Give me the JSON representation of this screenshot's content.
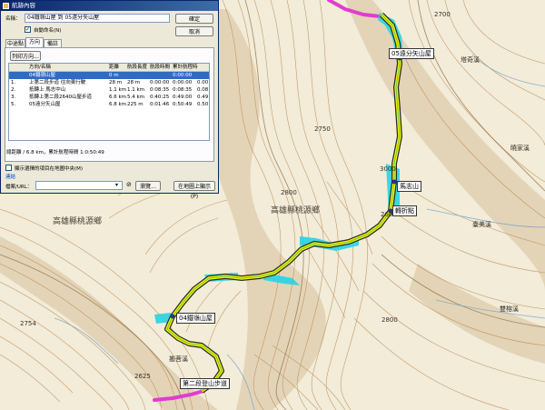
{
  "dialog": {
    "title": "航跡內容",
    "name_label": "名稱：",
    "name_value": "04鐵嶺山屋 到 05遠分矢山屋",
    "auto_name_label": "自動命名(N)",
    "ok_label": "確定",
    "cancel_label": "取消",
    "tabs": [
      {
        "label": "中途點"
      },
      {
        "label": "方向"
      },
      {
        "label": "備註"
      }
    ],
    "print_label": "列印方向...",
    "columns": {
      "name": "方向/名稱",
      "distance": "距離",
      "leg_length": "航段長度",
      "leg_time": "航段時間",
      "total_time": "累計航程時",
      "speed": ""
    },
    "rows": [
      {
        "num": "",
        "name": "04鐵嶺山屋",
        "distance": "0 m",
        "leg_length": "",
        "leg_time": "",
        "total_time": "0:00:00",
        "speed": "",
        "selected": true
      },
      {
        "num": "1.",
        "name": "上第二段步道 往向東行駛",
        "distance": "28 m",
        "leg_length": "28 m",
        "leg_time": "0:00:00",
        "total_time": "0:00:00",
        "speed": "0.00"
      },
      {
        "num": "2.",
        "name": "抵轉上 馬志中山",
        "distance": "1.1 km",
        "leg_length": "1.1 km",
        "leg_time": "0:08:35",
        "total_time": "0:08:35",
        "speed": "0.08"
      },
      {
        "num": "3.",
        "name": "抵轉上第二段2640山屋步道",
        "distance": "6.6 km",
        "leg_length": "5.4 km",
        "leg_time": "0:40:25",
        "total_time": "0:49:00",
        "speed": "0.49"
      },
      {
        "num": "5.",
        "name": "05遠分矢山屋",
        "distance": "6.8 km",
        "leg_length": "225 m",
        "leg_time": "0:01:46",
        "total_time": "0:50:49",
        "speed": "0.50"
      }
    ],
    "summary": "總距離 / 6.8 km，累計航程時間 1:0:50:49",
    "show_on_map_label": "顯示選擇的項目在地圖中央(M)",
    "link_section_label": "連結",
    "url_label": "檔案/URL：",
    "url_value": "",
    "browse_label": "瀏覽...",
    "show_map_label": "在地圖上顯示(P)"
  },
  "map": {
    "route_color": "#f5f500",
    "route_outline": "#2a2a2a",
    "highlight_color": "#27d4e6",
    "track_color": "#e03ccf",
    "area_labels": [
      {
        "text": "高雄縣桃源鄉"
      },
      {
        "text": "高雄縣桃源鄉"
      }
    ],
    "spot_labels": [
      {
        "text": "2700"
      },
      {
        "text": "2800"
      },
      {
        "text": "3000"
      },
      {
        "text": "2750"
      },
      {
        "text": "2600"
      },
      {
        "text": "2754"
      },
      {
        "text": "2625"
      },
      {
        "text": "2800"
      }
    ],
    "water_labels": [
      {
        "text": "塔奇溪"
      },
      {
        "text": "曉家溪"
      },
      {
        "text": "臺美溪"
      },
      {
        "text": "搬菩溪"
      },
      {
        "text": "雙榕溪"
      }
    ],
    "waypoints": [
      {
        "text": "05遠分矢山屋"
      },
      {
        "text": "馬志山"
      },
      {
        "text": "轉折點"
      },
      {
        "text": "04鐵嶺山屋"
      },
      {
        "text": "第二段登山步道"
      }
    ]
  }
}
